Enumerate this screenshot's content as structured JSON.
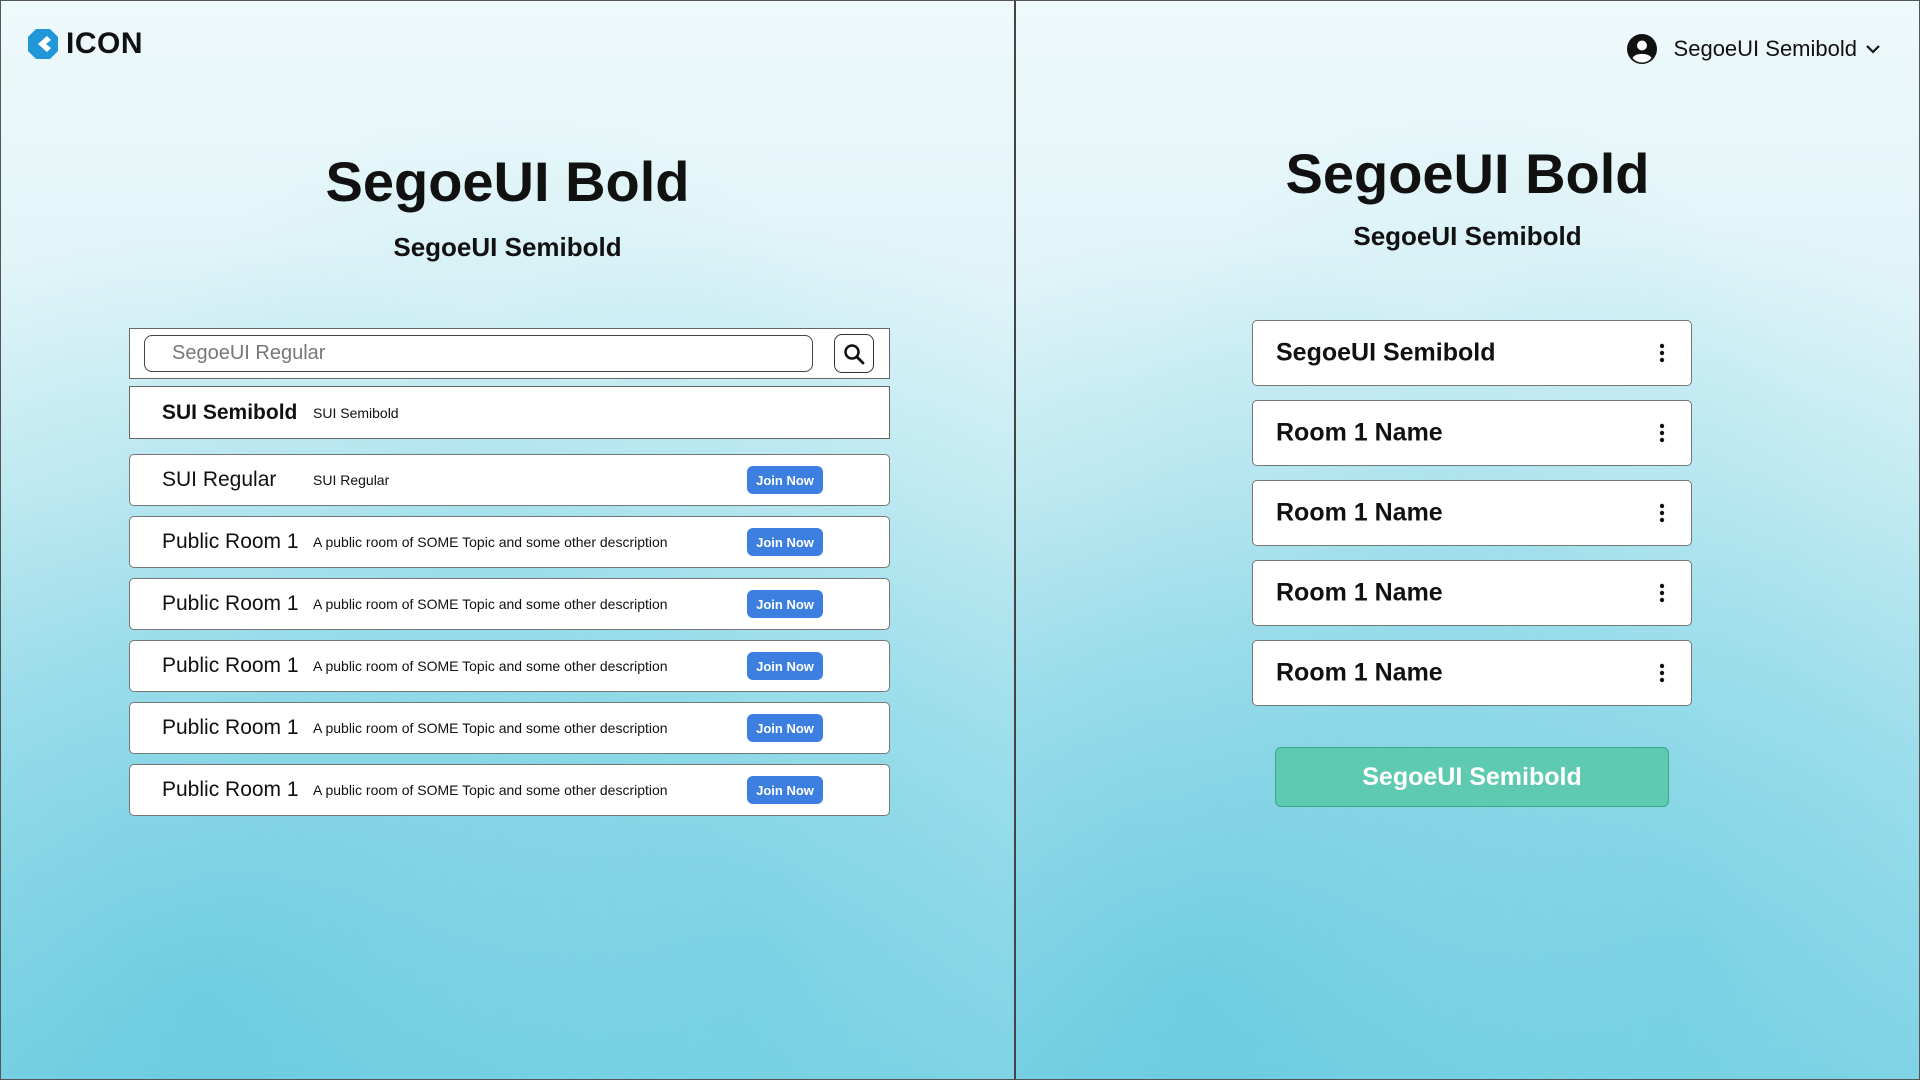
{
  "logo": {
    "text": "ICON"
  },
  "left": {
    "title": "SegoeUI Bold",
    "subtitle": "SegoeUI Semibold",
    "search": {
      "placeholder": "SegoeUI Regular",
      "value": ""
    },
    "table_header": {
      "name": "SUI Semibold",
      "description": "SUI Semibold"
    },
    "rooms": [
      {
        "name": "SUI Regular",
        "description": "SUI Regular",
        "action": "Join Now"
      },
      {
        "name": "Public Room 1",
        "description": "A public room of SOME Topic and some other description",
        "action": "Join Now"
      },
      {
        "name": "Public Room 1",
        "description": "A public room of SOME Topic and some other description",
        "action": "Join Now"
      },
      {
        "name": "Public Room 1",
        "description": "A public room of SOME Topic and some other description",
        "action": "Join Now"
      },
      {
        "name": "Public Room 1",
        "description": "A public room of SOME Topic and some other description",
        "action": "Join Now"
      },
      {
        "name": "Public Room 1",
        "description": "A public room of SOME Topic and some other description",
        "action": "Join Now"
      }
    ]
  },
  "right": {
    "user": {
      "name": "SegoeUI Semibold",
      "icon": "user-circle-icon"
    },
    "title": "SegoeUI Bold",
    "subtitle": "SegoeUI Semibold",
    "my_rooms": [
      {
        "name": "SegoeUI Semibold"
      },
      {
        "name": "Room 1 Name"
      },
      {
        "name": "Room 1 Name"
      },
      {
        "name": "Room 1 Name"
      },
      {
        "name": "Room 1 Name"
      }
    ],
    "create_button": "SegoeUI Semibold"
  },
  "colors": {
    "accent_blue": "#3d7fe0",
    "accent_teal": "#5ecbb0",
    "logo_blue": "#2196d8"
  }
}
